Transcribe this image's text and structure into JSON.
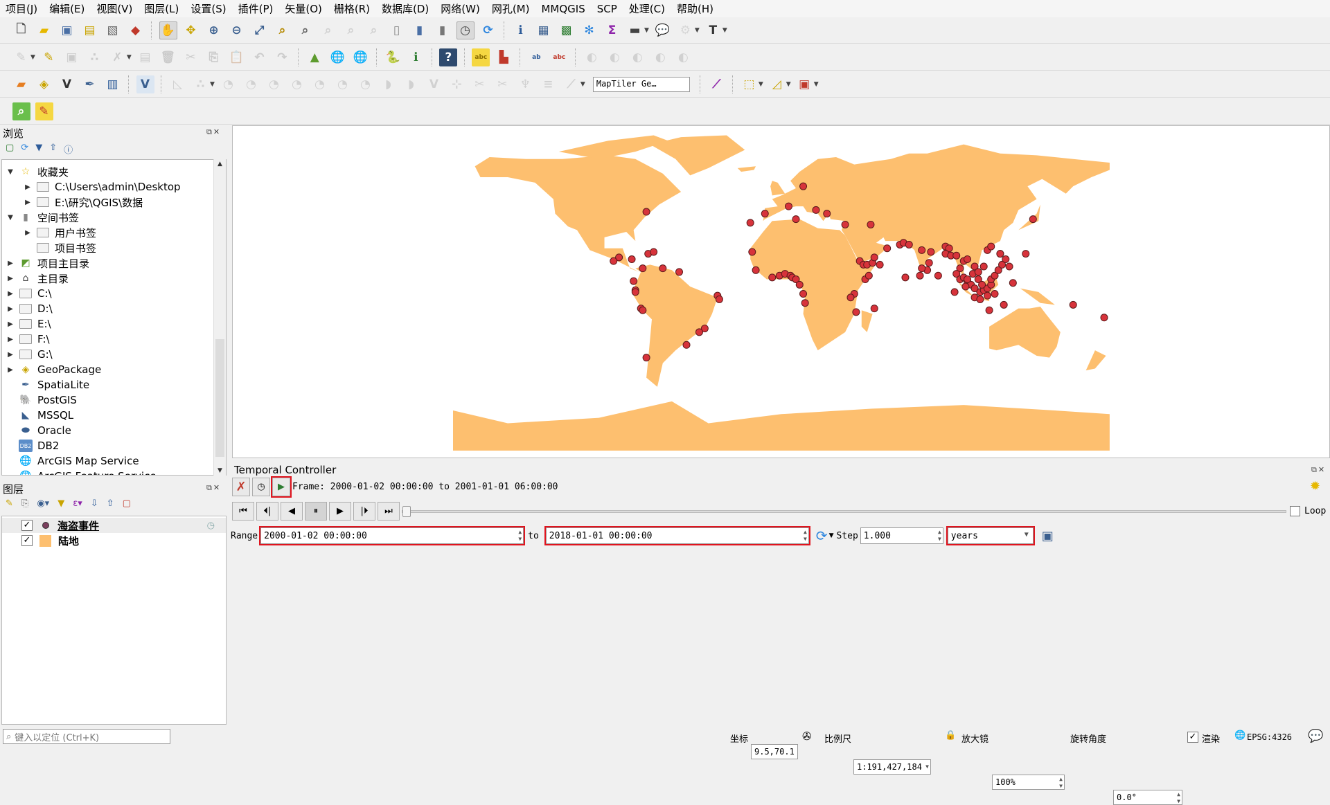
{
  "menu": [
    "项目(J)",
    "编辑(E)",
    "视图(V)",
    "图层(L)",
    "设置(S)",
    "插件(P)",
    "矢量(O)",
    "栅格(R)",
    "数据库(D)",
    "网络(W)",
    "网孔(M)",
    "MMQGIS",
    "SCP",
    "处理(C)",
    "帮助(H)"
  ],
  "toolbars": [
    [
      {
        "n": "new-project-icon",
        "g": "🗋",
        "c": "#555"
      },
      {
        "n": "open-project-icon",
        "g": "▰",
        "c": "#e6b800"
      },
      {
        "n": "save-project-icon",
        "g": "▣",
        "c": "#4a6fa5"
      },
      {
        "n": "new-print-layout-icon",
        "g": "▤",
        "c": "#c9a400"
      },
      {
        "n": "layout-manager-icon",
        "g": "▧",
        "c": "#666"
      },
      {
        "n": "style-manager-icon",
        "g": "◆",
        "c": "#c0392b"
      },
      "|",
      {
        "n": "pan-icon",
        "g": "✋",
        "c": "#333",
        "a": 1
      },
      {
        "n": "pan-to-selection-icon",
        "g": "✥",
        "c": "#c9a400"
      },
      {
        "n": "zoom-in-icon",
        "g": "⊕",
        "c": "#3a5f8f"
      },
      {
        "n": "zoom-out-icon",
        "g": "⊖",
        "c": "#3a5f8f"
      },
      {
        "n": "zoom-full-icon",
        "g": "⤢",
        "c": "#3a5f8f"
      },
      {
        "n": "zoom-to-selection-icon",
        "g": "⌕",
        "c": "#b58900"
      },
      {
        "n": "zoom-to-layer-icon",
        "g": "⌕",
        "c": "#666"
      },
      {
        "n": "zoom-native-icon",
        "g": "⌕",
        "c": "#999",
        "d": 1
      },
      {
        "n": "zoom-last-icon",
        "g": "⌕",
        "c": "#999",
        "d": 1
      },
      {
        "n": "zoom-next-icon",
        "g": "⌕",
        "c": "#999",
        "d": 1
      },
      {
        "n": "new-map-view-icon",
        "g": "▯",
        "c": "#888"
      },
      {
        "n": "new-bookmark-icon",
        "g": "▮",
        "c": "#4a6fa5"
      },
      {
        "n": "show-bookmarks-icon",
        "g": "▮",
        "c": "#777"
      },
      {
        "n": "temporal-controller-icon",
        "g": "◷",
        "c": "#444",
        "a": 1
      },
      {
        "n": "refresh-icon",
        "g": "⟳",
        "c": "#2e86de"
      },
      "|",
      {
        "n": "identify-icon",
        "g": "ℹ",
        "c": "#2e5c99"
      },
      {
        "n": "attribute-table-icon",
        "g": "▦",
        "c": "#3a5f8f"
      },
      {
        "n": "field-calculator-icon",
        "g": "▩",
        "c": "#2e7d32"
      },
      {
        "n": "processing-toolbox-icon",
        "g": "✻",
        "c": "#2e86de"
      },
      {
        "n": "statistics-icon",
        "g": "Σ",
        "c": "#8e24aa"
      },
      {
        "n": "measure-icon",
        "g": "▬",
        "c": "#444",
        "dd": 1
      },
      {
        "n": "map-tips-icon",
        "g": "💬",
        "c": "#e6c200"
      },
      {
        "n": "locator-icon",
        "g": "⚙",
        "c": "#aaa",
        "dd": 1,
        "d": 1
      },
      {
        "n": "text-annotation-icon",
        "g": "T",
        "c": "#333",
        "dd": 1
      }
    ],
    [
      {
        "n": "current-edits-icon",
        "g": "✎",
        "c": "#888",
        "d": 1,
        "dd": 1
      },
      {
        "n": "toggle-editing-icon",
        "g": "✎",
        "c": "#c9a400"
      },
      {
        "n": "save-edits-icon",
        "g": "▣",
        "c": "#888",
        "d": 1
      },
      {
        "n": "add-feature-icon",
        "g": "∴",
        "c": "#888",
        "d": 1
      },
      {
        "n": "vertex-tool-icon",
        "g": "✗",
        "c": "#888",
        "d": 1,
        "dd": 1
      },
      {
        "n": "modify-attributes-icon",
        "g": "▤",
        "c": "#888",
        "d": 1
      },
      {
        "n": "delete-selected-icon",
        "g": "🗑",
        "c": "#888",
        "d": 1
      },
      {
        "n": "cut-features-icon",
        "g": "✂",
        "c": "#888",
        "d": 1
      },
      {
        "n": "copy-features-icon",
        "g": "⎘",
        "c": "#888",
        "d": 1
      },
      {
        "n": "paste-features-icon",
        "g": "📋",
        "c": "#888",
        "d": 1
      },
      {
        "n": "undo-icon",
        "g": "↶",
        "c": "#888",
        "d": 1
      },
      {
        "n": "redo-icon",
        "g": "↷",
        "c": "#888",
        "d": 1
      },
      "|",
      {
        "n": "georeferencer-icon",
        "g": "▲",
        "c": "#5d9b2e"
      },
      {
        "n": "add-wms-icon",
        "g": "🌐",
        "c": "#3a5f8f"
      },
      {
        "n": "add-wfs-icon",
        "g": "🌐",
        "c": "#3a5f8f"
      },
      "|",
      {
        "n": "python-console-icon",
        "g": "🐍",
        "c": "#2e5c99"
      },
      {
        "n": "plugin-info-icon",
        "g": "ℹ",
        "c": "#2e7d32"
      },
      "|",
      {
        "n": "help-icon",
        "g": "?",
        "c": "#fff",
        "bg": "#2e4a6e"
      },
      "|",
      {
        "n": "label-tool-icon",
        "g": "abc",
        "c": "#8a6d00",
        "s": 9,
        "bg": "#f5d742"
      },
      {
        "n": "diagram-icon",
        "g": "▙",
        "c": "#c0392b"
      },
      "|",
      {
        "n": "pin-labels-icon",
        "g": "ab",
        "c": "#2e5c99",
        "s": 9
      },
      {
        "n": "hide-labels-icon",
        "g": "abc",
        "c": "#c0392b",
        "s": 9
      },
      "|",
      {
        "n": "move-label-icon",
        "g": "◐",
        "c": "#999",
        "d": 1
      },
      {
        "n": "show-hide-labels-icon",
        "g": "◐",
        "c": "#999",
        "d": 1
      },
      {
        "n": "rotate-label-icon",
        "g": "◐",
        "c": "#999",
        "d": 1
      },
      {
        "n": "change-label-icon",
        "g": "◐",
        "c": "#999",
        "d": 1
      },
      {
        "n": "label-properties-icon",
        "g": "◐",
        "c": "#999",
        "d": 1
      }
    ],
    [
      {
        "n": "data-source-manager-icon",
        "g": "▰",
        "c": "#e67e22"
      },
      {
        "n": "new-geopackage-icon",
        "g": "◈",
        "c": "#c9a400"
      },
      {
        "n": "new-shapefile-icon",
        "g": "V",
        "c": "#333"
      },
      {
        "n": "new-spatialite-icon",
        "g": "✒",
        "c": "#3a5f8f"
      },
      {
        "n": "new-temporary-layer-icon",
        "g": "▥",
        "c": "#2e5c99"
      },
      "|",
      {
        "n": "new-virtual-layer-icon",
        "g": "V",
        "c": "#3a5f8f",
        "bg": "#dbe6f2"
      },
      "|",
      {
        "n": "digitize-right-angle-icon",
        "g": "◺",
        "c": "#999",
        "d": 1
      },
      {
        "n": "add-ring-icon",
        "g": "∴",
        "c": "#999",
        "d": 1,
        "dd": 1
      },
      {
        "n": "add-part-icon",
        "g": "◔",
        "c": "#999",
        "d": 1
      },
      {
        "n": "fill-ring-icon",
        "g": "◔",
        "c": "#999",
        "d": 1
      },
      {
        "n": "delete-ring-icon",
        "g": "◔",
        "c": "#999",
        "d": 1
      },
      {
        "n": "delete-part-icon",
        "g": "◔",
        "c": "#999",
        "d": 1
      },
      {
        "n": "reshape-icon",
        "g": "◔",
        "c": "#999",
        "d": 1
      },
      {
        "n": "offset-curve-icon",
        "g": "◔",
        "c": "#999",
        "d": 1
      },
      {
        "n": "split-parts-icon",
        "g": "◔",
        "c": "#999",
        "d": 1
      },
      {
        "n": "split-features-icon",
        "g": "◗",
        "c": "#999",
        "d": 1
      },
      {
        "n": "merge-features-icon",
        "g": "◗",
        "c": "#999",
        "d": 1
      },
      {
        "n": "merge-attributes-icon",
        "g": "V",
        "c": "#999",
        "d": 1
      },
      {
        "n": "rotate-point-icon",
        "g": "⊹",
        "c": "#999",
        "d": 1
      },
      {
        "n": "simplify-icon",
        "g": "✂",
        "c": "#999",
        "d": 1
      },
      {
        "n": "reverse-line-icon",
        "g": "✂",
        "c": "#999",
        "d": 1
      },
      {
        "n": "trim-extend-icon",
        "g": "♆",
        "c": "#999",
        "d": 1
      },
      {
        "n": "align-icon",
        "g": "≡",
        "c": "#999",
        "d": 1
      },
      {
        "n": "shape-digitize-icon",
        "g": "⟋",
        "c": "#999",
        "d": 1,
        "dd": 1
      },
      {
        "type": "input",
        "n": "locator-search-input",
        "v": "MapTiler Ge…"
      },
      "|",
      {
        "n": "profile-tool-icon",
        "g": "⟋",
        "c": "#8e24aa"
      },
      "|",
      {
        "n": "select-features-icon",
        "g": "⬚",
        "c": "#c9a400",
        "dd": 1
      },
      {
        "n": "select-by-value-icon",
        "g": "◿",
        "c": "#c9a400",
        "dd": 1
      },
      {
        "n": "deselect-icon",
        "g": "▣",
        "c": "#c0392b",
        "dd": 1
      }
    ],
    [
      {
        "n": "scp-search-icon",
        "g": "⌕",
        "c": "#fff",
        "bg": "#6abf4b"
      },
      {
        "n": "scp-tools-icon",
        "g": "✎",
        "c": "#c0392b",
        "bg": "#f5d742"
      }
    ]
  ],
  "browser": {
    "title": "浏览",
    "items": [
      {
        "label": "收藏夹",
        "lvl": 0,
        "exp": "open",
        "icon": "star-icon"
      },
      {
        "label": "C:\\Users\\admin\\Desktop",
        "lvl": 1,
        "exp": "closed",
        "icon": "folder-icon"
      },
      {
        "label": "E:\\研究\\QGIS\\数据",
        "lvl": 1,
        "exp": "closed",
        "icon": "folder-icon"
      },
      {
        "label": "空间书签",
        "lvl": 0,
        "exp": "open",
        "icon": "bookmark-icon"
      },
      {
        "label": "用户书签",
        "lvl": 1,
        "exp": "closed",
        "icon": "folder-icon"
      },
      {
        "label": "项目书签",
        "lvl": 1,
        "exp": "",
        "icon": "folder-icon"
      },
      {
        "label": "项目主目录",
        "lvl": 0,
        "exp": "closed",
        "icon": "project-home-icon"
      },
      {
        "label": "主目录",
        "lvl": 0,
        "exp": "closed",
        "icon": "home-icon"
      },
      {
        "label": "C:\\",
        "lvl": 0,
        "exp": "closed",
        "icon": "folder-icon"
      },
      {
        "label": "D:\\",
        "lvl": 0,
        "exp": "closed",
        "icon": "folder-icon"
      },
      {
        "label": "E:\\",
        "lvl": 0,
        "exp": "closed",
        "icon": "folder-icon"
      },
      {
        "label": "F:\\",
        "lvl": 0,
        "exp": "closed",
        "icon": "folder-icon"
      },
      {
        "label": "G:\\",
        "lvl": 0,
        "exp": "closed",
        "icon": "folder-icon"
      },
      {
        "label": "GeoPackage",
        "lvl": 0,
        "exp": "closed",
        "icon": "geopackage-icon"
      },
      {
        "label": "SpatiaLite",
        "lvl": 0,
        "exp": "",
        "icon": "spatialite-icon"
      },
      {
        "label": "PostGIS",
        "lvl": 0,
        "exp": "",
        "icon": "postgis-icon"
      },
      {
        "label": "MSSQL",
        "lvl": 0,
        "exp": "",
        "icon": "mssql-icon"
      },
      {
        "label": "Oracle",
        "lvl": 0,
        "exp": "",
        "icon": "oracle-icon"
      },
      {
        "label": "DB2",
        "lvl": 0,
        "exp": "",
        "icon": "db2-icon"
      },
      {
        "label": "ArcGIS Map Service",
        "lvl": 0,
        "exp": "",
        "icon": "arcgis-map-service-icon"
      },
      {
        "label": "ArcGIS Feature Service",
        "lvl": 0,
        "exp": "",
        "icon": "arcgis-feature-service-icon"
      }
    ]
  },
  "layers": {
    "title": "图层",
    "items": [
      {
        "label": "海盗事件",
        "checked": true,
        "color": "#7b3f5e",
        "kind": "point",
        "temporal": true
      },
      {
        "label": "陆地",
        "checked": true,
        "color": "#fdbf6f",
        "kind": "polygon"
      }
    ]
  },
  "map": {
    "land_color": "#fdbf6f",
    "point_color": "#d7333b",
    "point_stroke": "#5a1a1a",
    "points": [
      [
        -74,
        41
      ],
      [
        -89,
        16
      ],
      [
        -92,
        14
      ],
      [
        -82,
        15
      ],
      [
        -73,
        18
      ],
      [
        -70,
        19
      ],
      [
        -76,
        10
      ],
      [
        -65,
        10
      ],
      [
        -56,
        8
      ],
      [
        -81,
        3
      ],
      [
        -80,
        -2
      ],
      [
        -80,
        -3
      ],
      [
        -77,
        -12
      ],
      [
        -76,
        -13
      ],
      [
        -35,
        -5
      ],
      [
        -34,
        -7
      ],
      [
        -42,
        -23
      ],
      [
        -45,
        -25
      ],
      [
        -52,
        -32
      ],
      [
        -74,
        -39
      ],
      [
        12,
        55
      ],
      [
        4,
        44
      ],
      [
        19,
        42
      ],
      [
        25,
        40
      ],
      [
        -9,
        40
      ],
      [
        -17,
        35
      ],
      [
        8,
        37
      ],
      [
        35,
        34
      ],
      [
        49,
        34
      ],
      [
        -16,
        19
      ],
      [
        -14,
        9
      ],
      [
        -5,
        5
      ],
      [
        -1,
        6
      ],
      [
        2,
        7
      ],
      [
        5,
        6
      ],
      [
        6,
        5
      ],
      [
        8,
        4
      ],
      [
        10,
        1
      ],
      [
        12,
        -4
      ],
      [
        13,
        -9
      ],
      [
        40,
        -4
      ],
      [
        38,
        -6
      ],
      [
        46,
        4
      ],
      [
        48,
        6
      ],
      [
        43,
        14
      ],
      [
        45,
        12
      ],
      [
        47,
        12
      ],
      [
        50,
        13
      ],
      [
        54,
        12
      ],
      [
        51,
        16
      ],
      [
        58,
        21
      ],
      [
        65,
        23
      ],
      [
        67,
        24
      ],
      [
        70,
        23
      ],
      [
        77,
        20
      ],
      [
        51,
        -12
      ],
      [
        41,
        -14
      ],
      [
        82,
        19
      ],
      [
        90,
        22
      ],
      [
        92,
        21
      ],
      [
        90,
        18
      ],
      [
        81,
        13
      ],
      [
        80,
        9
      ],
      [
        77,
        10
      ],
      [
        68,
        5
      ],
      [
        76,
        6
      ],
      [
        86,
        6
      ],
      [
        93,
        17
      ],
      [
        96,
        17
      ],
      [
        98,
        10
      ],
      [
        100,
        14
      ],
      [
        102,
        15
      ],
      [
        105,
        7
      ],
      [
        106,
        11
      ],
      [
        108,
        8
      ],
      [
        96,
        7
      ],
      [
        98,
        4
      ],
      [
        100,
        5
      ],
      [
        102,
        3
      ],
      [
        104,
        1
      ],
      [
        106,
        -1
      ],
      [
        109,
        -3
      ],
      [
        111,
        -2
      ],
      [
        113,
        -1
      ],
      [
        115,
        1
      ],
      [
        106,
        -6
      ],
      [
        109,
        -7
      ],
      [
        113,
        -5
      ],
      [
        117,
        -4
      ],
      [
        115,
        4
      ],
      [
        117,
        6
      ],
      [
        119,
        9
      ],
      [
        121,
        12
      ],
      [
        123,
        15
      ],
      [
        120,
        18
      ],
      [
        125,
        11
      ],
      [
        127,
        2
      ],
      [
        113,
        20
      ],
      [
        115,
        22
      ],
      [
        120,
        18
      ],
      [
        134,
        18
      ],
      [
        138,
        37
      ],
      [
        102,
        4
      ],
      [
        95,
        -3
      ],
      [
        122,
        -10
      ],
      [
        114,
        -13
      ],
      [
        160,
        -10
      ],
      [
        177,
        -17
      ],
      [
        111,
        11
      ],
      [
        108,
        4
      ],
      [
        110,
        1
      ],
      [
        101,
        0
      ]
    ]
  },
  "temporal": {
    "title": "Temporal Controller",
    "frame_label": "Frame: 2000-01-02 00:00:00 to 2001-01-01 06:00:00",
    "range_label": "Range",
    "range_start": "2000-01-02 00:00:00",
    "to_label": "to",
    "range_end": "2018-01-01 00:00:00",
    "step_label": "Step",
    "step_value": "1.000",
    "step_unit": "years",
    "loop_label": "Loop",
    "loop_checked": false,
    "slider_progress": 0
  },
  "status": {
    "search_placeholder": "键入以定位 (Ctrl+K)",
    "coord_label": "坐标",
    "coord_value": "9.5,70.1",
    "scale_label": "比例尺",
    "scale_value": "1:191,427,184",
    "magnifier_label": "放大镜",
    "magnifier_value": "100%",
    "rotation_label": "旋转角度",
    "rotation_value": "0.0°",
    "render_label": "渲染",
    "render_checked": true,
    "crs": "EPSG:4326"
  }
}
